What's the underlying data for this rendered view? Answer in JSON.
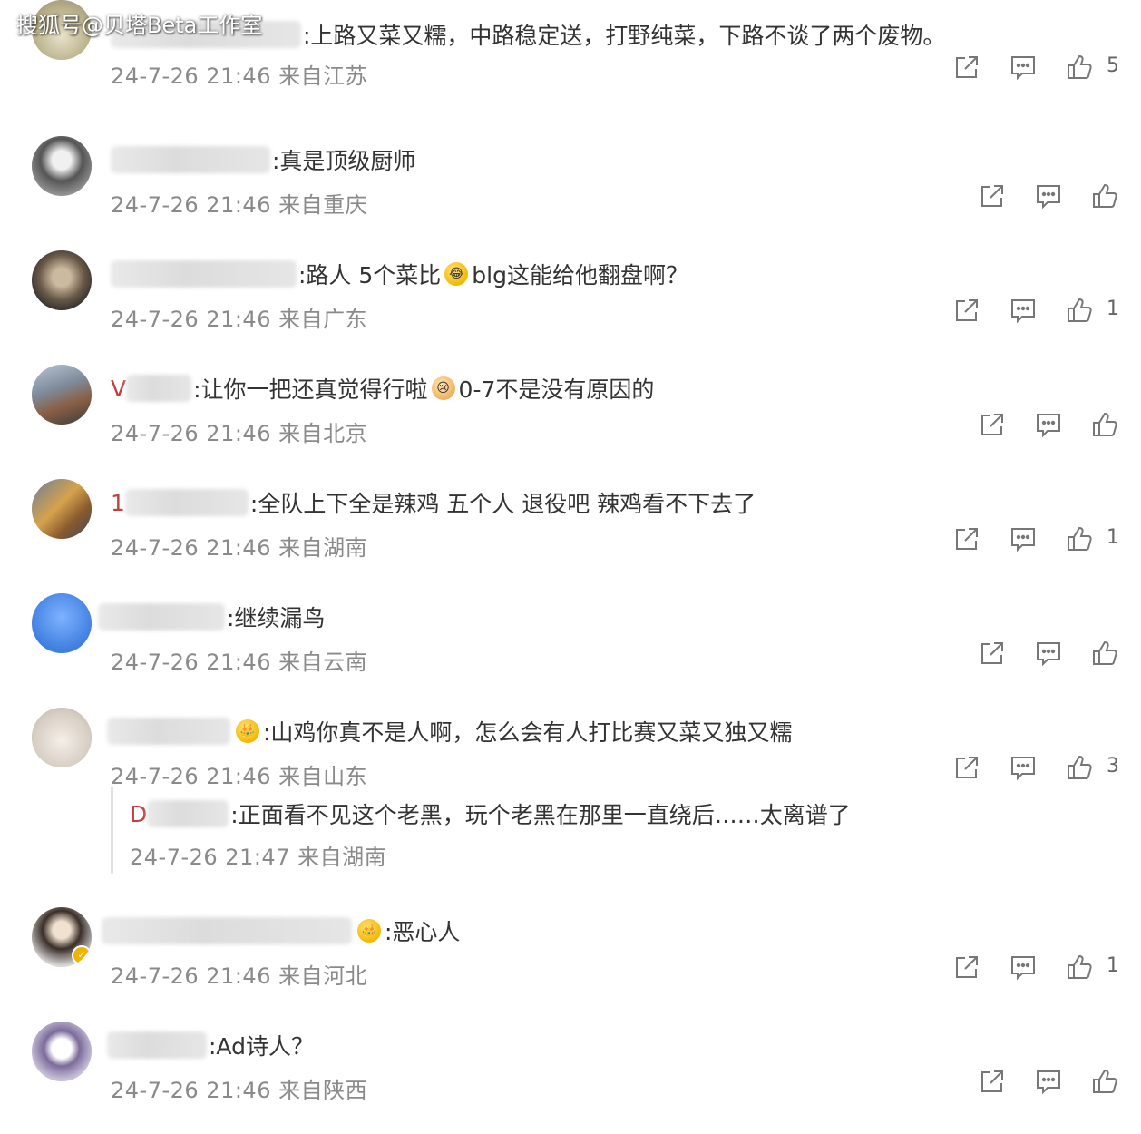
{
  "watermark": "搜狐号@贝塔Beta工作室",
  "comments": [
    {
      "text": ":上路又菜又糯，中路稳定送，打野纯菜，下路不谈了两个废物。",
      "meta": "24-7-26 21:46 来自江苏",
      "likes": "5"
    },
    {
      "text": ":真是顶级厨师",
      "meta": "24-7-26 21:46 来自重庆",
      "likes": ""
    },
    {
      "text_a": ":路人  5个菜比",
      "text_b": " blg这能给他翻盘啊？",
      "meta": "24-7-26 21:46 来自广东",
      "likes": "1"
    },
    {
      "name_prefix": "V",
      "text_a": ":让你一把还真觉得行啦",
      "text_b": "0-7不是没有原因的",
      "meta": "24-7-26 21:46 来自北京",
      "likes": ""
    },
    {
      "name_prefix": "1",
      "text": ":全队上下全是辣鸡 五个人 退役吧  辣鸡看不下去了",
      "meta": "24-7-26 21:46 来自湖南",
      "likes": "1"
    },
    {
      "text": ":继续漏鸟",
      "meta": "24-7-26 21:46 来自云南",
      "likes": ""
    },
    {
      "text": ":山鸡你真不是人啊，怎么会有人打比赛又菜又独又糯",
      "meta": "24-7-26 21:46 来自山东",
      "likes": "3"
    },
    {
      "text": ":恶心人",
      "meta": "24-7-26 21:46 来自河北",
      "likes": "1"
    },
    {
      "text": ":Ad诗人？",
      "meta": "24-7-26 21:46 来自陕西",
      "likes": ""
    }
  ],
  "reply": {
    "name_prefix": "D",
    "text": ":正面看不见这个老黑，玩个老黑在那里一直绕后……太离谱了",
    "meta": "24-7-26 21:47 来自湖南"
  }
}
